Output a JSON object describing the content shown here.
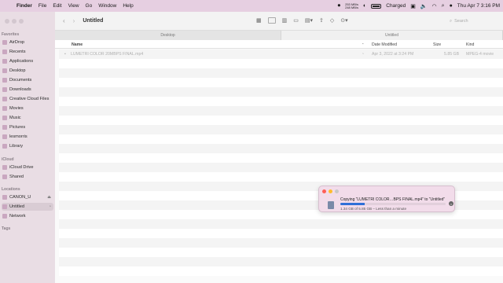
{
  "menubar": {
    "app_name": "Finder",
    "items": [
      "File",
      "Edit",
      "View",
      "Go",
      "Window",
      "Help"
    ],
    "net_up": "253 MB/s",
    "net_down": "248 MB/s",
    "battery_label": "Charged",
    "datetime": "Thu Apr 7  3:16 PM"
  },
  "toolbar": {
    "title": "Untitled",
    "search_placeholder": "Search"
  },
  "path_tabs": [
    "Desktop",
    "Untitled"
  ],
  "sidebar": {
    "favorites_label": "Favorites",
    "favorites": [
      "AirDrop",
      "Recents",
      "Applications",
      "Desktop",
      "Documents",
      "Downloads",
      "Creative Cloud Files",
      "Movies",
      "Music",
      "Pictures",
      "lesmorris",
      "Library"
    ],
    "icloud_label": "iCloud",
    "icloud": [
      "iCloud Drive",
      "Shared"
    ],
    "locations_label": "Locations",
    "locations": [
      "CANON_U",
      "Untitled",
      "Network"
    ],
    "tags_label": "Tags"
  },
  "columns": {
    "name": "Name",
    "date_modified": "Date Modified",
    "size": "Size",
    "kind": "Kind"
  },
  "files": [
    {
      "name": "LUMETRI COLOR 20MBPS FINAL.mp4",
      "date_modified": "Apr 3, 2022 at 3:24 PM",
      "size": "5.85 GB",
      "kind": "MPEG-4 movie"
    }
  ],
  "copy_dialog": {
    "message": "Copying “LUMETRI COLOR…BPS FINAL.mp4” to “Untitled”",
    "status": "1.34 GB of 5.85 GB – Less than a minute",
    "progress": 0.23
  },
  "colors": {
    "progress": "#2f6fd8",
    "close": "#ff5f57",
    "minimize": "#febc2e",
    "zoom": "#c8c8c8"
  }
}
